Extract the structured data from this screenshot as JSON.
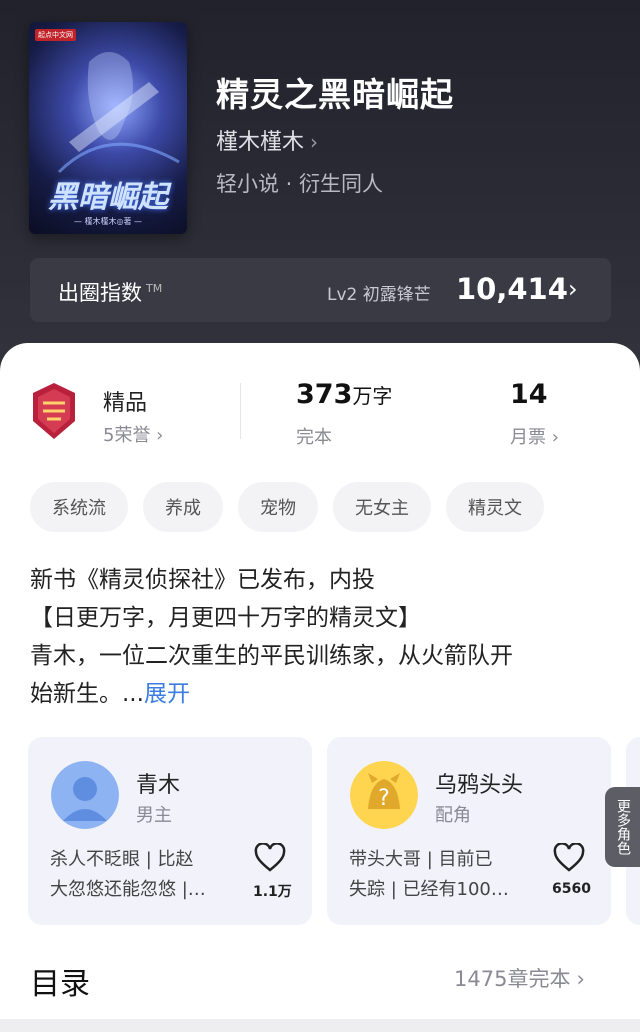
{
  "book": {
    "cover": {
      "publisher": "起点中文网",
      "title": "黑暗崛起",
      "author_line": "— 槿木槿木◎著 —"
    },
    "title": "精灵之黑暗崛起",
    "author": "槿木槿木",
    "author_chevron": "›",
    "genre": "轻小说 · 衍生同人"
  },
  "index_bar": {
    "label": "出圈指数",
    "tm": "TM",
    "level": "Lv2 初露锋芒",
    "value": "10,414",
    "chevron": "›"
  },
  "stats": {
    "quality": "精品",
    "honors": "5荣誉 ›",
    "word_count": "373",
    "word_unit": "万字",
    "status": "完本",
    "monthly_tickets": "14",
    "tickets_label": "月票 ›"
  },
  "tags": [
    "系统流",
    "养成",
    "宠物",
    "无女主",
    "精灵文"
  ],
  "synopsis": {
    "line1": "新书《精灵侦探社》已发布，内投",
    "line2": "【日更万字，月更四十万字的精灵文】",
    "line3": "青木，一位二次重生的平民训练家，从火箭队开",
    "line4": "始新生。...",
    "expand": "展开"
  },
  "characters": [
    {
      "name": "青木",
      "role": "男主",
      "desc_line1": "杀人不眨眼 | 比赵",
      "desc_line2": "大忽悠还能忽悠 |…",
      "likes": "1.1万"
    },
    {
      "name": "乌鸦头头",
      "role": "配角",
      "desc_line1": "带头大哥 | 目前已",
      "desc_line2": "失踪 | 已经有100…",
      "likes": "6560"
    }
  ],
  "more_roles": "更多角色",
  "toc": {
    "title": "目录",
    "count": "1475章完本",
    "chevron": "›"
  },
  "colors": {
    "hero_bg": "#2b2b35",
    "link_blue": "#3b7de0",
    "card_bg": "#f1f2fa"
  }
}
